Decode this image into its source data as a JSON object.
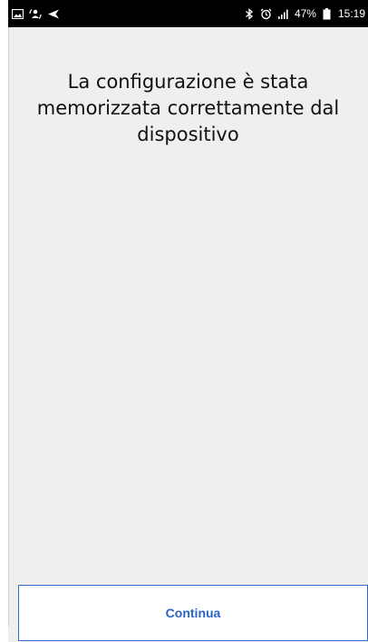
{
  "status_bar": {
    "left_icons": [
      "image-icon",
      "sync-person-icon",
      "navigation-arrow-icon"
    ],
    "right_icons": [
      "bluetooth-icon",
      "alarm-icon",
      "signal-icon",
      "battery-icon"
    ],
    "battery_percent": "47%",
    "time": "15:19"
  },
  "main": {
    "message": "La configurazione è stata memorizzata correttamente dal dispositivo"
  },
  "footer": {
    "continue_label": "Continua"
  },
  "colors": {
    "background": "#efefef",
    "status_bar": "#000000",
    "accent": "#2a64c4"
  }
}
